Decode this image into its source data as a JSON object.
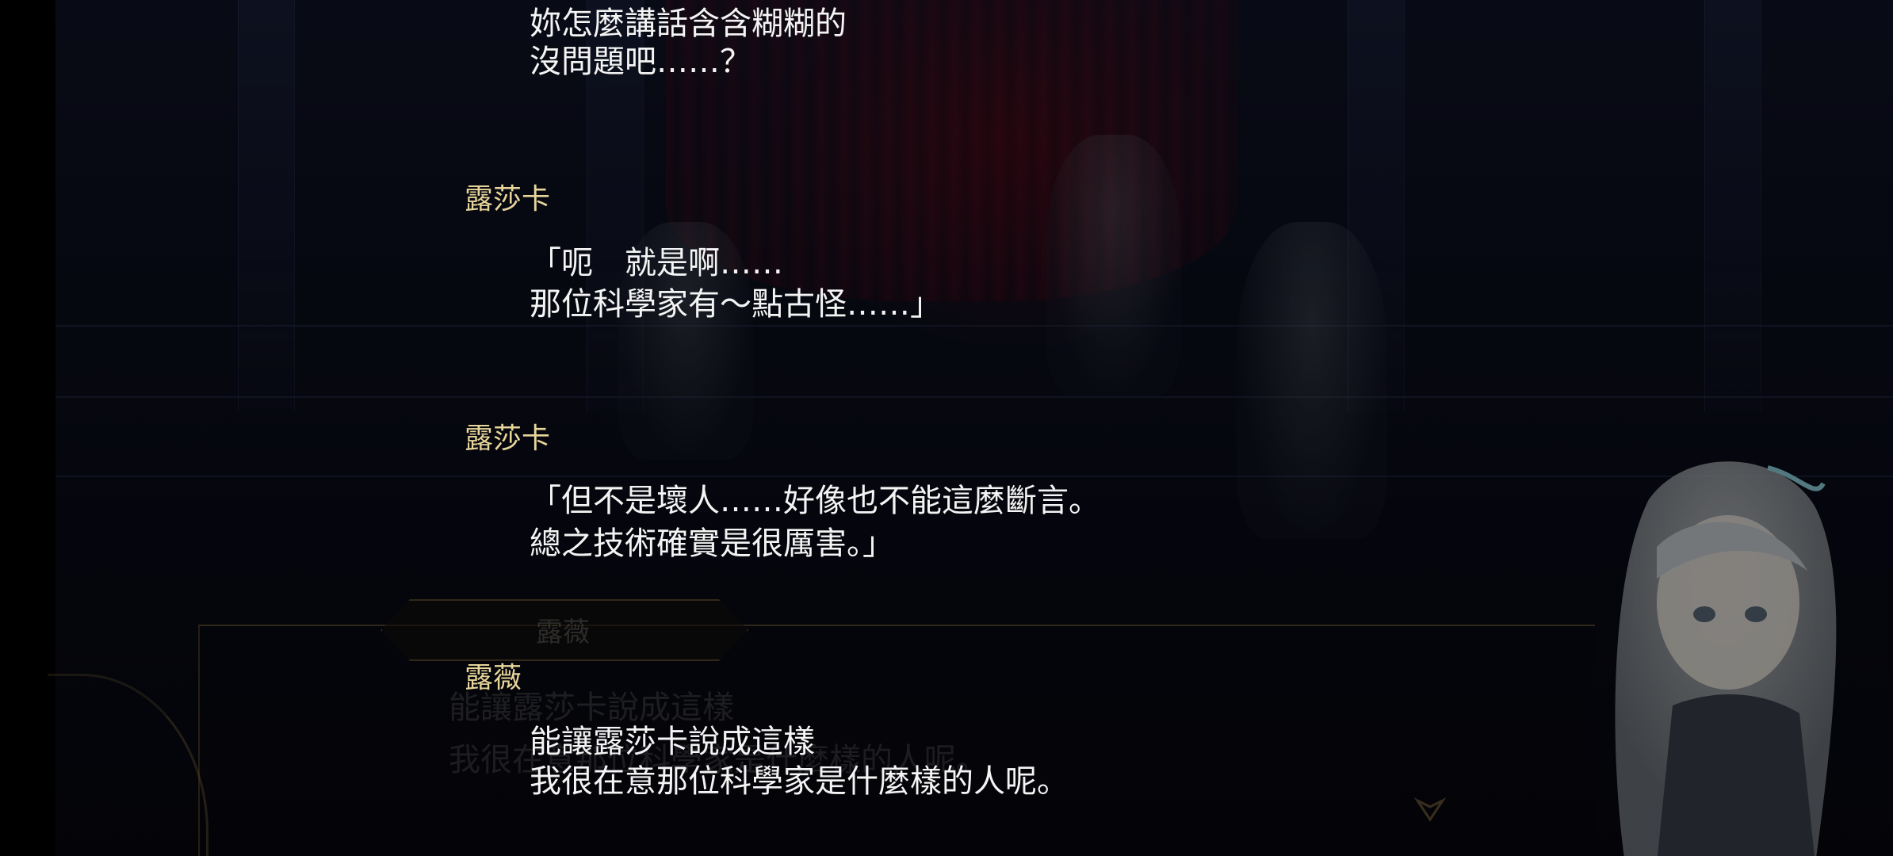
{
  "backlog": [
    {
      "speaker": "",
      "lines": [
        "妳怎麼講話含含糊糊的",
        "沒問題吧……？"
      ]
    },
    {
      "speaker": "露莎卡",
      "lines": [
        "「呃　就是啊……",
        "那位科學家有～點古怪……」"
      ]
    },
    {
      "speaker": "露莎卡",
      "lines": [
        "「但不是壞人……好像也不能這麼斷言。",
        "總之技術確實是很厲害。」"
      ]
    },
    {
      "speaker": "露薇",
      "lines": [
        "能讓露莎卡說成這樣",
        "我很在意那位科學家是什麼樣的人呢。"
      ]
    }
  ],
  "message_window": {
    "name": "露薇",
    "lines": [
      "能讓露莎卡說成這樣",
      "我很在意那位科學家是什麼樣的人呢。"
    ]
  },
  "icons": {
    "next": "next-arrow-icon"
  },
  "colors": {
    "speaker_name": "#e8d59a",
    "dialogue_text": "#f4f4f4",
    "frame_gold": "#aa8c50"
  }
}
